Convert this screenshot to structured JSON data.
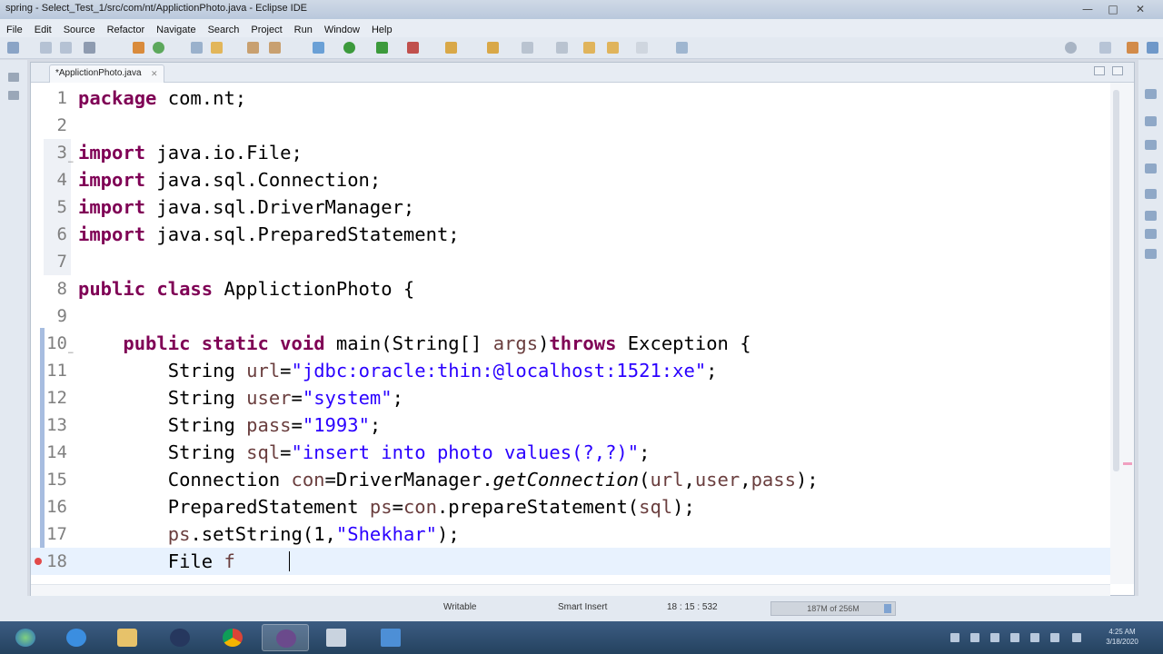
{
  "window": {
    "title": "spring - Select_Test_1/src/com/nt/ApplictionPhoto.java - Eclipse IDE"
  },
  "menu": [
    "File",
    "Edit",
    "Source",
    "Refactor",
    "Navigate",
    "Search",
    "Project",
    "Run",
    "Window",
    "Help"
  ],
  "editor": {
    "tab_label": "*ApplictionPhoto.java",
    "lines": [
      {
        "num": "1",
        "html": "<span class=\"kw\">package</span> com.nt;"
      },
      {
        "num": "2",
        "html": ""
      },
      {
        "num": "3",
        "html": "<span class=\"kw\">import</span> java.io.File;"
      },
      {
        "num": "4",
        "html": "<span class=\"kw\">import</span> java.sql.Connection;"
      },
      {
        "num": "5",
        "html": "<span class=\"kw\">import</span> java.sql.DriverManager;"
      },
      {
        "num": "6",
        "html": "<span class=\"kw\">import</span> java.sql.PreparedStatement;"
      },
      {
        "num": "7",
        "html": ""
      },
      {
        "num": "8",
        "html": "<span class=\"kw\">public class</span> ApplictionPhoto {"
      },
      {
        "num": "9",
        "html": ""
      },
      {
        "num": "10",
        "html": "    <span class=\"kw\">public static void</span> main(String[] <span class=\"var\">args</span>)<span class=\"kw\">throws</span> Exception {"
      },
      {
        "num": "11",
        "html": "        String <span class=\"var\">url</span>=<span class=\"str\">\"jdbc:oracle:thin:@localhost:1521:xe\"</span>;"
      },
      {
        "num": "12",
        "html": "        String <span class=\"var\">user</span>=<span class=\"str\">\"system\"</span>;"
      },
      {
        "num": "13",
        "html": "        String <span class=\"var\">pass</span>=<span class=\"str\">\"1993\"</span>;"
      },
      {
        "num": "14",
        "html": "        String <span class=\"var\">sql</span>=<span class=\"str\">\"insert into photo values(?,?)\"</span>;"
      },
      {
        "num": "15",
        "html": "        Connection <span class=\"var\">con</span>=DriverManager.<i>getConnection</i>(<span class=\"var\">url</span>,<span class=\"var\">user</span>,<span class=\"var\">pass</span>);"
      },
      {
        "num": "16",
        "html": "        PreparedStatement <span class=\"var\">ps</span>=<span class=\"var\">con</span>.prepareStatement(<span class=\"var\">sql</span>);"
      },
      {
        "num": "17",
        "html": "        <span class=\"var\">ps</span>.setString(1,<span class=\"str\">\"Shekhar\"</span>);"
      },
      {
        "num": "18",
        "html": "        File <span class=\"var\">f</span>"
      }
    ]
  },
  "status": {
    "mode": "Writable",
    "insert": "Smart Insert",
    "position": "18 : 15 : 532",
    "heap": "187M of 256M"
  },
  "taskbar": {
    "clock_time": "4:25 AM",
    "clock_date": "3/18/2020"
  },
  "colors": {
    "keyword": "#7f0055",
    "string": "#2a00ff",
    "variable": "#6a3e3e",
    "current_line": "#e8f2fe"
  }
}
